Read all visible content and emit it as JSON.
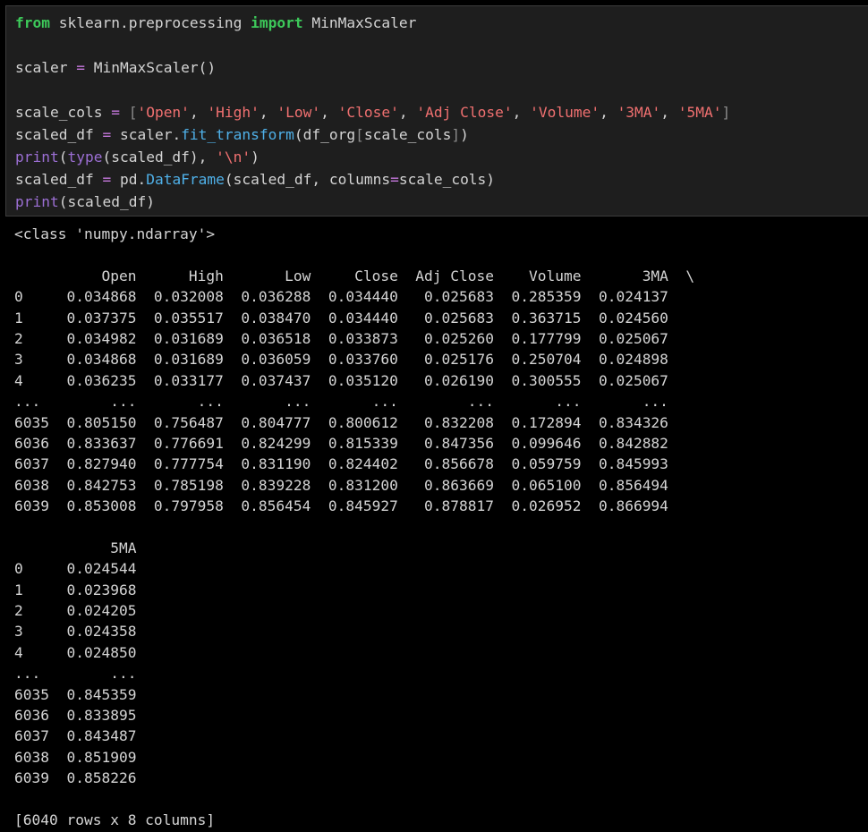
{
  "code_cell": {
    "lines": [
      [
        {
          "t": "from",
          "c": "kw"
        },
        {
          "t": " sklearn.preprocessing ",
          "c": "plain"
        },
        {
          "t": "import",
          "c": "kw"
        },
        {
          "t": " MinMaxScaler",
          "c": "plain"
        }
      ],
      [],
      [
        {
          "t": "scaler ",
          "c": "plain"
        },
        {
          "t": "=",
          "c": "op"
        },
        {
          "t": " MinMaxScaler()",
          "c": "plain"
        }
      ],
      [],
      [
        {
          "t": "scale_cols ",
          "c": "plain"
        },
        {
          "t": "=",
          "c": "op"
        },
        {
          "t": " ",
          "c": "plain"
        },
        {
          "t": "[",
          "c": "punct"
        },
        {
          "t": "'Open'",
          "c": "str"
        },
        {
          "t": ", ",
          "c": "plain"
        },
        {
          "t": "'High'",
          "c": "str"
        },
        {
          "t": ", ",
          "c": "plain"
        },
        {
          "t": "'Low'",
          "c": "str"
        },
        {
          "t": ", ",
          "c": "plain"
        },
        {
          "t": "'Close'",
          "c": "str"
        },
        {
          "t": ", ",
          "c": "plain"
        },
        {
          "t": "'Adj Close'",
          "c": "str"
        },
        {
          "t": ", ",
          "c": "plain"
        },
        {
          "t": "'Volume'",
          "c": "str"
        },
        {
          "t": ", ",
          "c": "plain"
        },
        {
          "t": "'3MA'",
          "c": "str"
        },
        {
          "t": ", ",
          "c": "plain"
        },
        {
          "t": "'5MA'",
          "c": "str"
        },
        {
          "t": "]",
          "c": "punct"
        }
      ],
      [
        {
          "t": "scaled_df ",
          "c": "plain"
        },
        {
          "t": "=",
          "c": "op"
        },
        {
          "t": " scaler.",
          "c": "plain"
        },
        {
          "t": "fit_transform",
          "c": "call"
        },
        {
          "t": "(df_org",
          "c": "plain"
        },
        {
          "t": "[",
          "c": "punct"
        },
        {
          "t": "scale_cols",
          "c": "plain"
        },
        {
          "t": "]",
          "c": "punct"
        },
        {
          "t": ")",
          "c": "plain"
        }
      ],
      [
        {
          "t": "print",
          "c": "builtin"
        },
        {
          "t": "(",
          "c": "plain"
        },
        {
          "t": "type",
          "c": "builtin"
        },
        {
          "t": "(scaled_df), ",
          "c": "plain"
        },
        {
          "t": "'\\n'",
          "c": "str"
        },
        {
          "t": ")",
          "c": "plain"
        }
      ],
      [
        {
          "t": "scaled_df ",
          "c": "plain"
        },
        {
          "t": "=",
          "c": "op"
        },
        {
          "t": " pd.",
          "c": "plain"
        },
        {
          "t": "DataFrame",
          "c": "call"
        },
        {
          "t": "(scaled_df, columns",
          "c": "plain"
        },
        {
          "t": "=",
          "c": "op"
        },
        {
          "t": "scale_cols)",
          "c": "plain"
        }
      ],
      [
        {
          "t": "print",
          "c": "builtin"
        },
        {
          "t": "(scaled_df)",
          "c": "plain"
        }
      ]
    ]
  },
  "output": {
    "lines": [
      "<class 'numpy.ndarray'>",
      "",
      "          Open      High       Low     Close  Adj Close    Volume       3MA  \\",
      "0     0.034868  0.032008  0.036288  0.034440   0.025683  0.285359  0.024137   ",
      "1     0.037375  0.035517  0.038470  0.034440   0.025683  0.363715  0.024560   ",
      "2     0.034982  0.031689  0.036518  0.033873   0.025260  0.177799  0.025067   ",
      "3     0.034868  0.031689  0.036059  0.033760   0.025176  0.250704  0.024898   ",
      "4     0.036235  0.033177  0.037437  0.035120   0.026190  0.300555  0.025067   ",
      "...        ...       ...       ...       ...        ...       ...       ...   ",
      "6035  0.805150  0.756487  0.804777  0.800612   0.832208  0.172894  0.834326   ",
      "6036  0.833637  0.776691  0.824299  0.815339   0.847356  0.099646  0.842882   ",
      "6037  0.827940  0.777754  0.831190  0.824402   0.856678  0.059759  0.845993   ",
      "6038  0.842753  0.785198  0.839228  0.831200   0.863669  0.065100  0.856494   ",
      "6039  0.853008  0.797958  0.856454  0.845927   0.878817  0.026952  0.866994   ",
      "",
      "           5MA  ",
      "0     0.024544  ",
      "1     0.023968  ",
      "2     0.024205  ",
      "3     0.024358  ",
      "4     0.024850  ",
      "...        ...  ",
      "6035  0.845359  ",
      "6036  0.833895  ",
      "6037  0.843487  ",
      "6038  0.851909  ",
      "6039  0.858226  ",
      "",
      "[6040 rows x 8 columns]"
    ]
  },
  "colors": {
    "cell_background": "#1e1e1e",
    "output_background": "#000000",
    "keyword": "#3dc95a",
    "string": "#f07070",
    "builtin": "#9c6fd4",
    "call": "#4fb0e8",
    "operator": "#c678dd"
  }
}
